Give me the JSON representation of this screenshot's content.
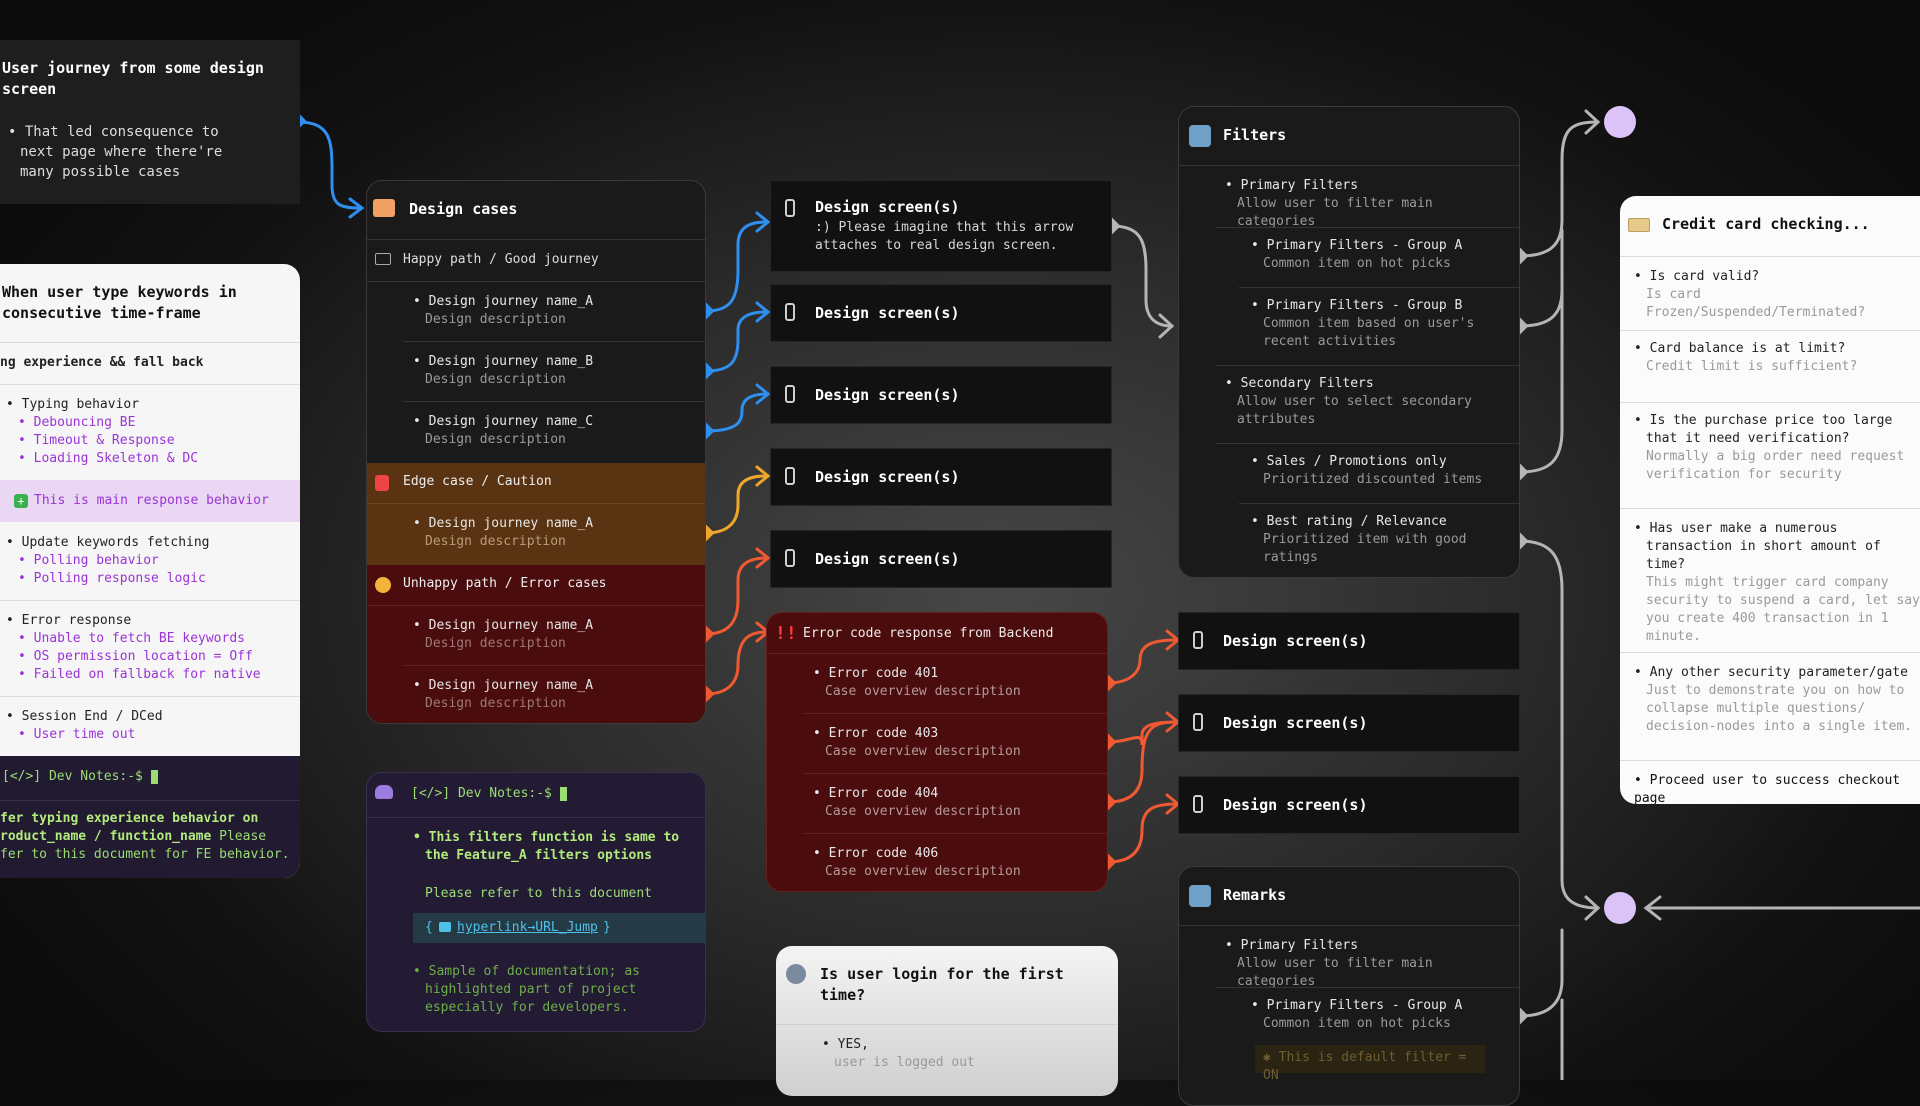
{
  "journey_card": {
    "title": "User journey from some design screen",
    "bullet": "That led consequence to next page where there're many possible cases"
  },
  "keywords_card": {
    "title": "When user type keywords in consecutive time-frame",
    "subtitle": "ng experience && fall back",
    "groups": [
      {
        "head": "Typing behavior",
        "items": [
          "Debouncing BE",
          "Timeout & Response",
          "Loading Skeleton & DC"
        ]
      },
      {
        "head": "Update keywords fetching",
        "items": [
          "Polling behavior",
          "Polling response logic"
        ]
      },
      {
        "head": "Error response",
        "items": [
          "Unable to fetch BE keywords",
          "OS permission location = Off",
          "Failed on fallback for native"
        ]
      },
      {
        "head": "Session End / DCed",
        "items": [
          "User time out"
        ]
      }
    ],
    "highlight": "This is main response behavior",
    "dev_prompt": "[</>] Dev Notes:-$",
    "dev_text_a": "fer typing experience behavior on",
    "dev_text_b": "roduct_name / function_name",
    "dev_text_c": "Please",
    "dev_text_d": "fer to this document for FE behavior."
  },
  "design_cases": {
    "title": "Design cases",
    "happy_label": "Happy path / Good journey",
    "happy_items": [
      {
        "name": "Design journey name_A",
        "desc": "Design description"
      },
      {
        "name": "Design journey name_B",
        "desc": "Design description"
      },
      {
        "name": "Design journey name_C",
        "desc": "Design description"
      }
    ],
    "edge_label": "Edge case / Caution",
    "edge_items": [
      {
        "name": "Design journey name_A",
        "desc": "Design description"
      }
    ],
    "unhappy_label": "Unhappy path / Error cases",
    "unhappy_items": [
      {
        "name": "Design journey name_A",
        "desc": "Design description"
      },
      {
        "name": "Design journey name_A",
        "desc": "Design description"
      }
    ]
  },
  "screens": {
    "label": "Design screen(s)",
    "first_desc": ":) Please imagine that this arrow attaches to real design screen."
  },
  "dev_notes": {
    "prompt": "[</>] Dev Notes:-$",
    "bold_line": "This filters function is same to the Feature_A filters options",
    "refer": "Please refer to this document",
    "link": "hyperlink→URL_Jump",
    "link_prefix": "{",
    "link_suffix": "}",
    "sample": "Sample of documentation; as highlighted part of project especially for developers."
  },
  "error_card": {
    "title": "Error code response from Backend",
    "items": [
      {
        "name": "Error code 401",
        "desc": "Case overview description"
      },
      {
        "name": "Error code 403",
        "desc": "Case overview description"
      },
      {
        "name": "Error code 404",
        "desc": "Case overview description"
      },
      {
        "name": "Error code 406",
        "desc": "Case overview description"
      }
    ]
  },
  "login_card": {
    "title": "Is user login for the first time?",
    "yes": "YES,",
    "yes_desc": "user is logged out"
  },
  "filters_card": {
    "title": "Filters",
    "primary": {
      "name": "Primary Filters",
      "desc": "Allow user to filter main categories"
    },
    "primary_a": {
      "name": "Primary Filters - Group A",
      "desc": "Common item on hot picks"
    },
    "primary_b": {
      "name": "Primary Filters - Group B",
      "desc": "Common item based on user's recent activities"
    },
    "secondary": {
      "name": "Secondary Filters",
      "desc": "Allow user to select secondary attributes"
    },
    "sales": {
      "name": "Sales / Promotions only",
      "desc": "Prioritized discounted items"
    },
    "rating": {
      "name": "Best rating / Relevance",
      "desc": "Prioritized item with good ratings"
    }
  },
  "remarks_card": {
    "title": "Remarks",
    "primary": {
      "name": "Primary Filters",
      "desc": "Allow user to filter main categories"
    },
    "primary_a": {
      "name": "Primary Filters - Group A",
      "desc": "Common item on hot picks"
    },
    "default_note": "This is default filter = ON"
  },
  "credit_card": {
    "title": "Credit card checking...",
    "items": [
      {
        "q": "Is card valid?",
        "a": "Is card Frozen/Suspended/Terminated?"
      },
      {
        "q": "Card balance is at limit?",
        "a": "Credit limit is sufficient?"
      },
      {
        "q": "Is the purchase price too large that it need verification?",
        "a": "Normally a big order need request verification for security"
      },
      {
        "q": "Has user make a numerous transaction in short amount of time?",
        "a": "This might trigger card company security to suspend a card, let say you create 400 transaction in 1 minute."
      },
      {
        "q": "Any other security parameter/gate",
        "a": "Just to demonstrate you on how to collapse multiple questions/ decision-nodes into a single item."
      }
    ],
    "final": "Proceed user to success checkout page"
  },
  "colors": {
    "blue": "#2f8ff0",
    "orange": "#f0a62a",
    "red": "#ef5a32",
    "grey": "#b5b5b5",
    "purple_node": "#dcc3f7",
    "edge_bg": "#5a3312",
    "error_bg": "#4a0c0c"
  }
}
